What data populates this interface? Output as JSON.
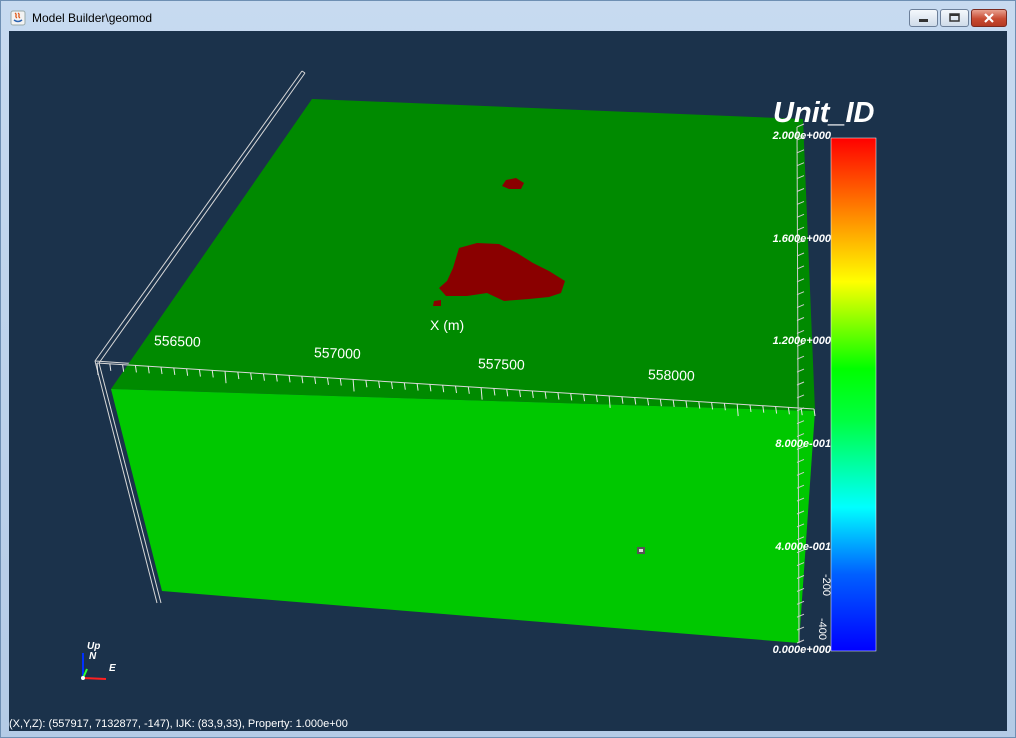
{
  "window": {
    "title": "Model Builder\\geomod",
    "controls": [
      "minimize",
      "maximize",
      "close"
    ]
  },
  "colorbar": {
    "title": "Unit_ID",
    "labels": [
      "2.000e+000",
      "1.600e+000",
      "1.200e+000",
      "8.000e-001",
      "4.000e-001",
      "0.000e+000"
    ],
    "colors": {
      "top": "#ff0000",
      "mid": "#00ff00",
      "low": "#00ffff",
      "bottom": "#0000ff"
    }
  },
  "axis": {
    "x_title": "X (m)",
    "x_ticks": [
      "556500",
      "557000",
      "557500",
      "558000"
    ],
    "side_ticks": [
      "-200",
      "-400"
    ]
  },
  "triad": {
    "up": "Up",
    "north": "N",
    "east": "E"
  },
  "status_text": "(X,Y,Z): (557917, 7132877,   -147), IJK: (83,9,33), Property: 1.000e+00",
  "model_colors": {
    "top_face": "#008a00",
    "front_face": "#00c800",
    "unit_2": "#8a0000",
    "background": "#1b324b"
  }
}
